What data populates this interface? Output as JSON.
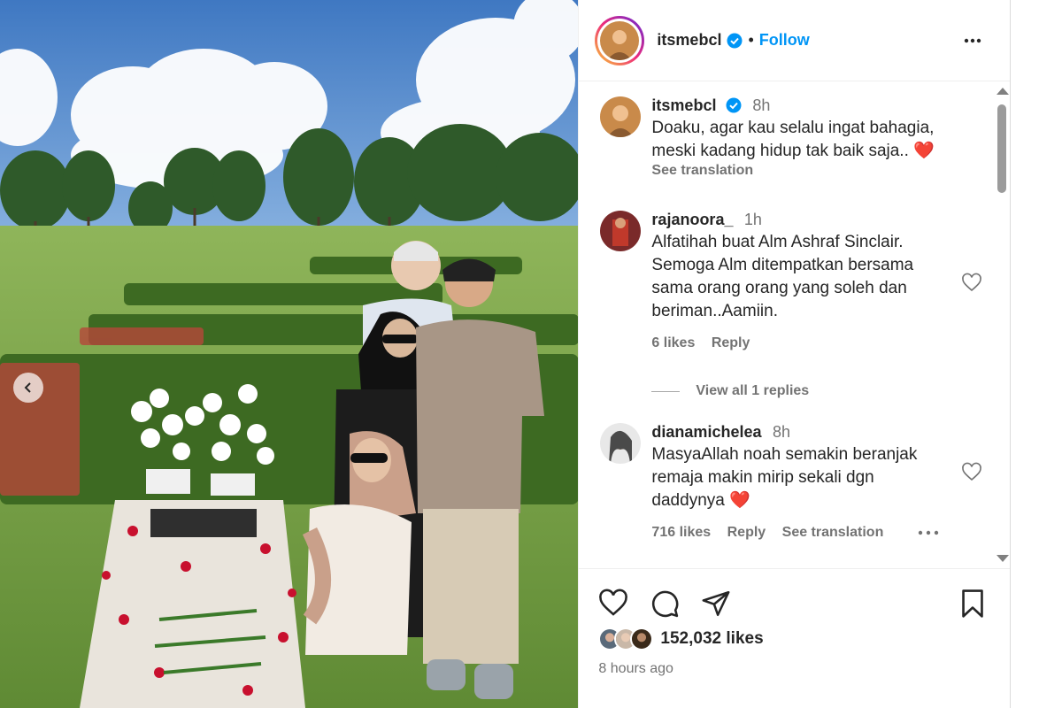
{
  "post": {
    "username": "itsmebcl",
    "follow_label": "Follow",
    "separator": "•",
    "caption": {
      "username": "itsmebcl",
      "time": "8h",
      "text": "Doaku, agar kau selalu ingat bahagia,\nmeski kadang hidup tak baik saja.. ",
      "emoji": "❤️",
      "see_translation": "See translation"
    },
    "comments": [
      {
        "username": "rajanoora_",
        "time": "1h",
        "text": "Alfatihah buat Alm Ashraf Sinclair.\nSemoga Alm ditempatkan bersama\nsama orang orang yang soleh dan\nberiman..Aamiin.",
        "likes": "6 likes",
        "reply": "Reply",
        "view_replies": "View all 1 replies"
      },
      {
        "username": "dianamichelea",
        "time": "8h",
        "text": "MasyaAllah noah semakin beranjak\nremaja makin mirip sekali dgn\ndaddynya ",
        "emoji": "❤️",
        "likes": "716 likes",
        "reply": "Reply",
        "see_translation": "See translation"
      }
    ],
    "likes_count": "152,032 likes",
    "time_ago": "8 hours ago"
  },
  "colors": {
    "accent": "#0095f6",
    "verified": "#0095f6",
    "heart": "#ed4956"
  },
  "icons": [
    "verified-icon",
    "more-options-icon",
    "heart-icon",
    "comment-icon",
    "share-icon",
    "bookmark-icon",
    "chevron-left-icon"
  ]
}
